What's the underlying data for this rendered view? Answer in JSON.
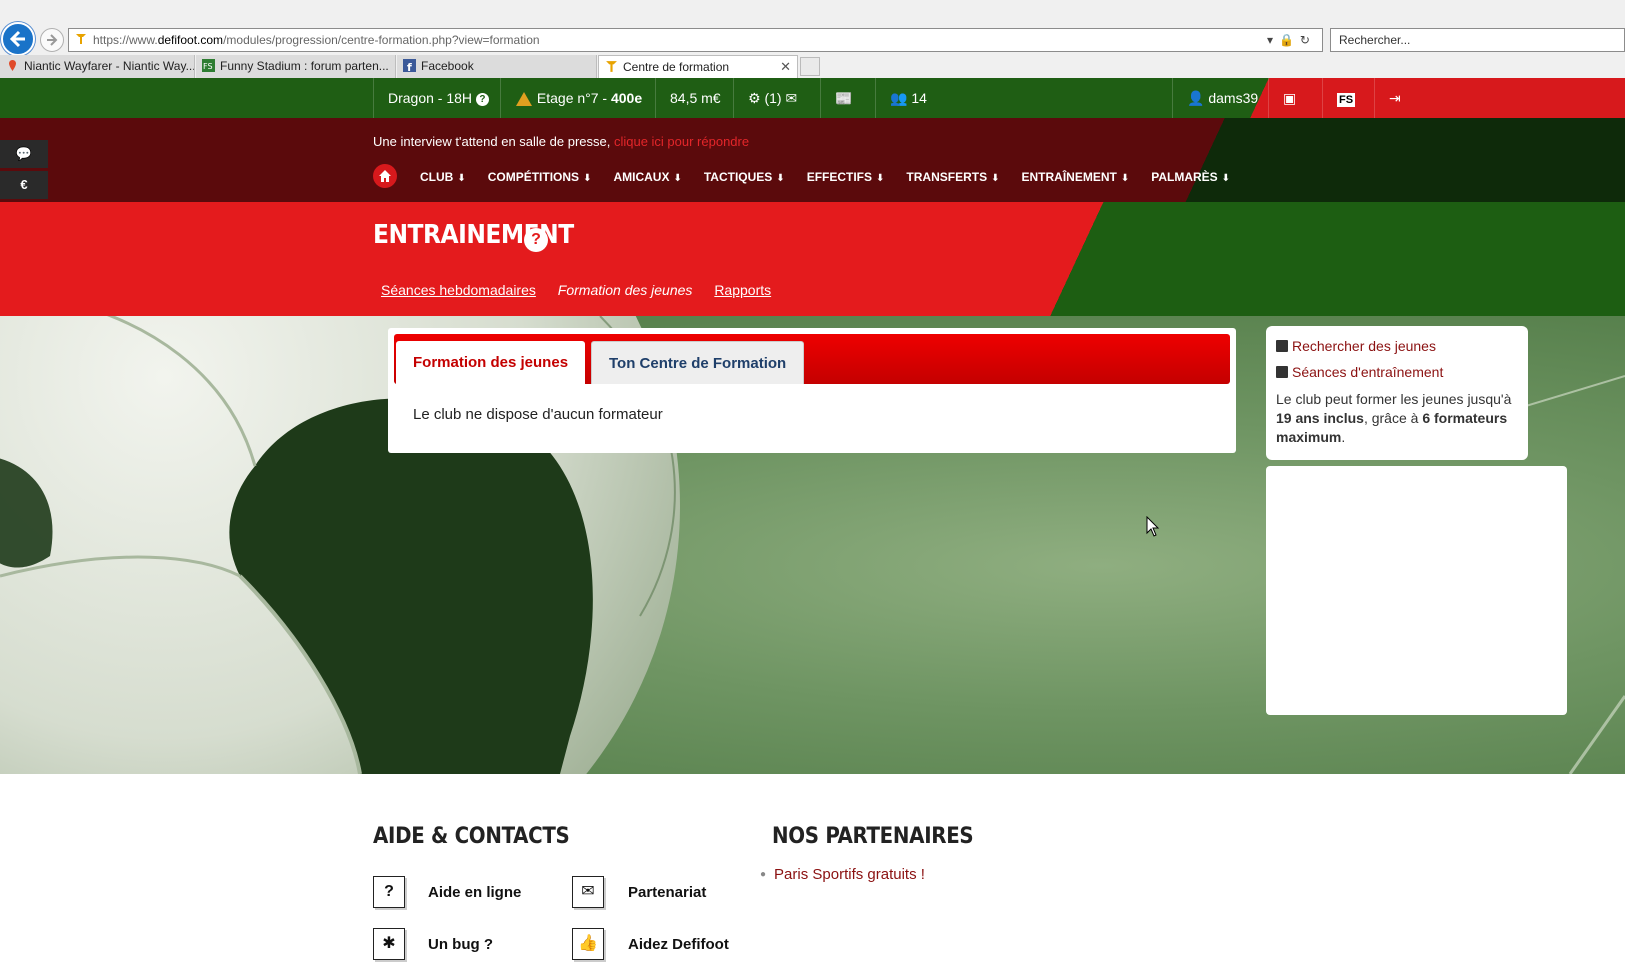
{
  "browser": {
    "url_prefix": "https://www.",
    "url_domain": "defifoot.com",
    "url_path": "/modules/progression/centre-formation.php?view=formation",
    "search_placeholder": "Rechercher...",
    "tabs": [
      {
        "label": "Niantic Wayfarer - Niantic Way...",
        "icon": "pin-icon"
      },
      {
        "label": "Funny Stadium : forum parten...",
        "icon": "fs-icon"
      },
      {
        "label": "Facebook",
        "icon": "facebook-icon"
      },
      {
        "label": "Centre de formation",
        "icon": "defifoot-icon",
        "active": true
      }
    ],
    "tab_close": "✕"
  },
  "topbar": {
    "team": "Dragon - 18H",
    "floor_prefix": "Etage n°7 - ",
    "floor_rank": "400e",
    "money": "84,5 m€",
    "settings_count": "(1)",
    "players_count": "14",
    "username": "dams39"
  },
  "side": {
    "chat_icon": "💬",
    "euro_icon": "€",
    "user_icon": "👤"
  },
  "nav": {
    "interview_text": "Une interview t'attend en salle de presse, ",
    "interview_link": "clique ici pour répondre",
    "items": [
      "CLUB",
      "COMPÉTITIONS",
      "AMICAUX",
      "TACTIQUES",
      "EFFECTIFS",
      "TRANSFERTS",
      "ENTRAÎNEMENT",
      "PALMARÈS"
    ],
    "arrow": "⬇"
  },
  "title": {
    "text": "ENTRAINEMENT",
    "help": "?",
    "subnav": [
      "Séances hebdomadaires",
      "Formation des jeunes",
      "Rapports"
    ]
  },
  "panel": {
    "tab_active": "Formation des jeunes",
    "tab_other": "Ton Centre de Formation",
    "message": "Le club ne dispose d'aucun formateur"
  },
  "sidebox": {
    "link1": "Rechercher des jeunes",
    "link2": "Séances d'entraînement",
    "info_pre": "Le club peut former les jeunes jusqu'à ",
    "info_age": "19 ans inclus",
    "info_mid": ", grâce à ",
    "info_count": "6 formateurs maximum",
    "info_end": "."
  },
  "footer": {
    "aide_title": "AIDE & CONTACTS",
    "partners_title": "NOS PARTENAIRES",
    "aide": "Aide en ligne",
    "partenariat": "Partenariat",
    "bug": "Un bug ?",
    "aidez": "Aidez Defifoot",
    "partner_link": "Paris Sportifs gratuits !"
  },
  "colors": {
    "green": "#1f5e14",
    "red": "#d7191c",
    "darkred": "#5b0a0c",
    "link": "#8b1111"
  }
}
